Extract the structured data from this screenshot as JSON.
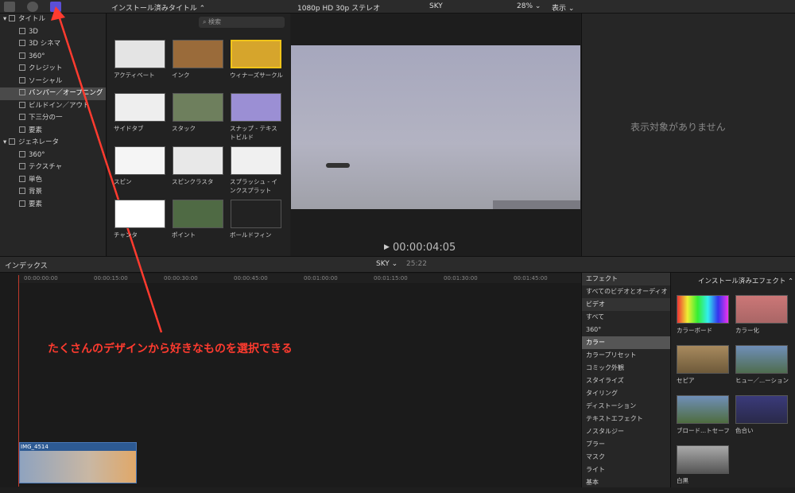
{
  "toolbar": {
    "browser_title": "インストール済みタイトル ⌃",
    "viewer_format": "1080p HD 30p ステレオ",
    "viewer_name": "SKY",
    "zoom": "28% ⌄",
    "view": "表示 ⌄"
  },
  "sidebar": {
    "items": [
      {
        "label": "タイトル",
        "head": true
      },
      {
        "label": "3D"
      },
      {
        "label": "3D シネマ"
      },
      {
        "label": "360°"
      },
      {
        "label": "クレジット"
      },
      {
        "label": "ソーシャル"
      },
      {
        "label": "バンパー／オープニング",
        "sel": true
      },
      {
        "label": "ビルドイン／アウト"
      },
      {
        "label": "下三分の一"
      },
      {
        "label": "要素"
      },
      {
        "label": "ジェネレータ",
        "head": true
      },
      {
        "label": "360°"
      },
      {
        "label": "テクスチャ"
      },
      {
        "label": "単色"
      },
      {
        "label": "背景"
      },
      {
        "label": "要素"
      }
    ]
  },
  "search": {
    "placeholder": "検索"
  },
  "tiles": [
    "アクティベート",
    "インク",
    "ウィナーズサークル",
    "サイドタブ",
    "スタック",
    "スナップ - テキストビルド",
    "スピン",
    "スピンクラスタ",
    "スプラッシュ - インクスプラット",
    "チャンタ",
    "ポイント",
    "ボールドフィン"
  ],
  "viewer": {
    "timecode": "00:00:04:05",
    "play": "▶"
  },
  "inspector": {
    "empty": "表示対象がありません"
  },
  "timeline_bar": {
    "index": "インデックス",
    "project": "SKY ⌄",
    "duration": "25:22"
  },
  "ruler": [
    "00:00:00:00",
    "00:00:15:00",
    "00:00:30:00",
    "00:00:45:00",
    "00:01:00:00",
    "00:01:15:00",
    "00:01:30:00",
    "00:01:45:00"
  ],
  "clip": {
    "name": "IMG_4514"
  },
  "effects": {
    "header": "エフェクト",
    "items": [
      {
        "label": "すべてのビデオとオーディオ"
      },
      {
        "label": "ビデオ",
        "head": true
      },
      {
        "label": "すべて"
      },
      {
        "label": "360°"
      },
      {
        "label": "カラー",
        "sel": true
      },
      {
        "label": "カラープリセット"
      },
      {
        "label": "コミック外観"
      },
      {
        "label": "スタイライズ"
      },
      {
        "label": "タイリング"
      },
      {
        "label": "ディストーション"
      },
      {
        "label": "テキストエフェクト"
      },
      {
        "label": "ノスタルジー"
      },
      {
        "label": "ブラー"
      },
      {
        "label": "マスク"
      },
      {
        "label": "ライト"
      },
      {
        "label": "基本"
      }
    ]
  },
  "fxgrid": {
    "title": "インストール済みエフェクト ⌃",
    "items": [
      "カラーボード",
      "カラー化",
      "セピア",
      "ヒュー／...ーション",
      "ブロード...トセーフ",
      "色合い",
      "白黒"
    ]
  },
  "annotation": "たくさんのデザインから好きなものを選択できる",
  "colors": {
    "accent": "#5b4fd6",
    "annotation": "#ff3b2f",
    "playhead": "#c0392b"
  }
}
